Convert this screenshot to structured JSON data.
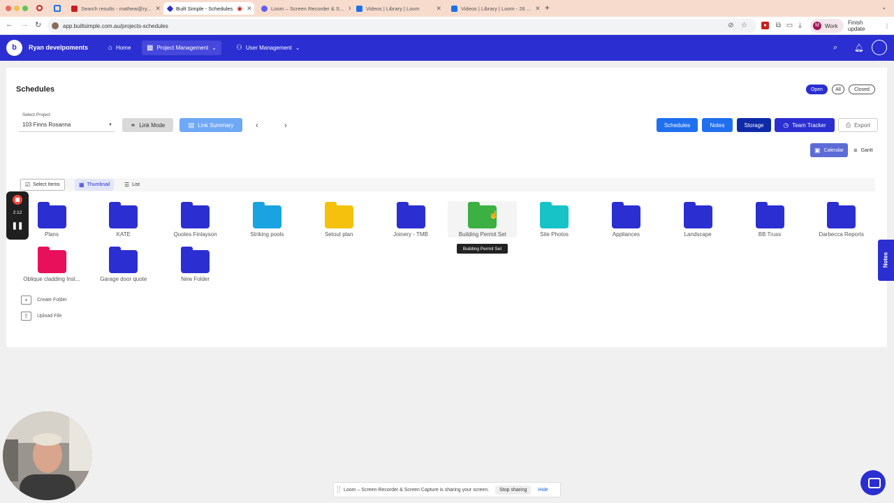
{
  "browser": {
    "tabs": [
      {
        "label": "Search results - mathew@ry...",
        "favicon_color": "#c5221f"
      },
      {
        "label": "Built Simple - Schedules",
        "favicon_color": "#2b2fd1",
        "active": true
      },
      {
        "label": "Loom – Screen Recorder & S...",
        "favicon_color": "#625df5"
      },
      {
        "label": "Videos | Library | Loom",
        "favicon_color": "#1a73e8"
      },
      {
        "label": "Videos | Library | Loom - 26 ...",
        "favicon_color": "#1a73e8"
      }
    ],
    "new_tab_symbol": "+",
    "url": "app.builtsimple.com.au/projects-schedules",
    "profile_initial": "M",
    "profile_label": "Work",
    "finish_update": "Finish update"
  },
  "app": {
    "logo_glyph": "b",
    "company": "Ryan develpoments",
    "nav": [
      {
        "label": "Home",
        "icon": "home-icon"
      },
      {
        "label": "Project Management",
        "icon": "grid-icon",
        "active": true
      },
      {
        "label": "User Management",
        "icon": "users-icon"
      }
    ]
  },
  "page": {
    "title": "Schedules",
    "status_filters": [
      "Open",
      "All",
      "Closed"
    ],
    "active_status": "Open",
    "select_project_label": "Select Project",
    "select_project_value": "103 Finns Rosanna",
    "link_mode": "Link Mode",
    "link_summary": "Link Summary",
    "buttons": {
      "schedules": "Schedules",
      "notes": "Notes",
      "storage": "Storage",
      "team_tracker": "Team Tracker",
      "export": "Export"
    },
    "view_toggle": {
      "calendar": "Calendar",
      "gantt": "Gantt"
    },
    "toolbar": {
      "select_items": "Select Items",
      "thumbnail": "Thumbnail",
      "list": "List"
    },
    "folders": [
      {
        "name": "Plans",
        "color": "#2b2fd1"
      },
      {
        "name": "KATE",
        "color": "#2b2fd1"
      },
      {
        "name": "Quotes Finlayson",
        "color": "#2b2fd1"
      },
      {
        "name": "Striking pools",
        "color": "#19a3e0"
      },
      {
        "name": "Setout plan",
        "color": "#f4c20d"
      },
      {
        "name": "Joinery - TMB",
        "color": "#2b2fd1"
      },
      {
        "name": "Building Permit Set",
        "color": "#3cb043"
      },
      {
        "name": "Site Photos",
        "color": "#17c3c7"
      },
      {
        "name": "Appliances",
        "color": "#2b2fd1"
      },
      {
        "name": "Landscape",
        "color": "#2b2fd1"
      },
      {
        "name": "BB Truss",
        "color": "#2b2fd1"
      },
      {
        "name": "Darbecca Reports",
        "color": "#2b2fd1"
      },
      {
        "name": "Oblique cladding Inst...",
        "color": "#e8105a"
      },
      {
        "name": "Garage door quote",
        "color": "#2b2fd1"
      },
      {
        "name": "New Folder",
        "color": "#2b2fd1"
      }
    ],
    "tooltip": "Building Permit Set",
    "create_folder": "Create Folder",
    "upload_file": "Upload File"
  },
  "loom": {
    "timer": "2:12",
    "notes_tab": "Notes",
    "share_message": "Loom – Screen Recorder & Screen Capture is sharing your screen.",
    "stop_sharing": "Stop sharing",
    "hide": "Hide"
  }
}
